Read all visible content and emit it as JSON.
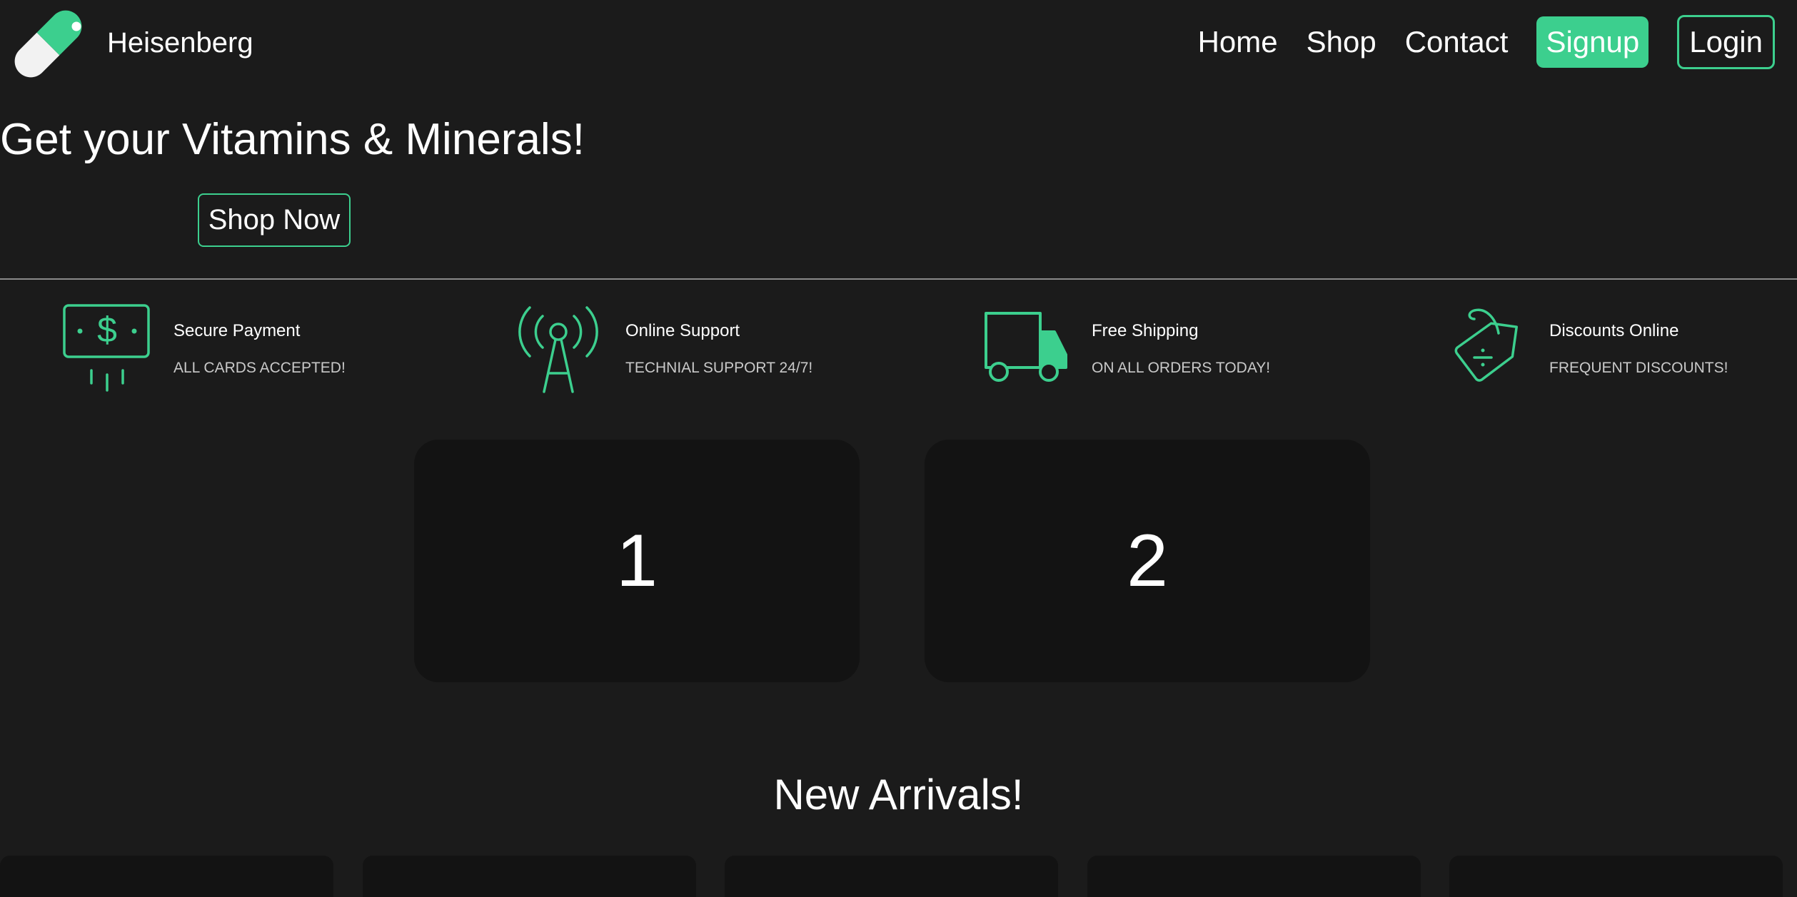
{
  "header": {
    "brand": "Heisenberg",
    "nav": [
      "Home",
      "Shop",
      "Contact"
    ],
    "signup_label": "Signup",
    "login_label": "Login"
  },
  "hero": {
    "title": "Get your Vitamins & Minerals!",
    "cta_label": "Shop Now"
  },
  "features": [
    {
      "icon": "money-icon",
      "title": "Secure Payment",
      "subtitle": "ALL CARDS ACCEPTED!"
    },
    {
      "icon": "antenna-tower-icon",
      "title": "Online Support",
      "subtitle": "TECHNIAL SUPPORT 24/7!"
    },
    {
      "icon": "truck-icon",
      "title": "Free Shipping",
      "subtitle": "ON ALL ORDERS TODAY!"
    },
    {
      "icon": "price-tag-icon",
      "title": "Discounts Online",
      "subtitle": "FREQUENT DISCOUNTS!"
    }
  ],
  "cards": [
    "1",
    "2"
  ],
  "new_arrivals": {
    "title": "New Arrivals!",
    "product_count_visible": 5
  },
  "colors": {
    "accent": "#3ccf8e",
    "background": "#1b1b1b",
    "card": "#131313"
  }
}
